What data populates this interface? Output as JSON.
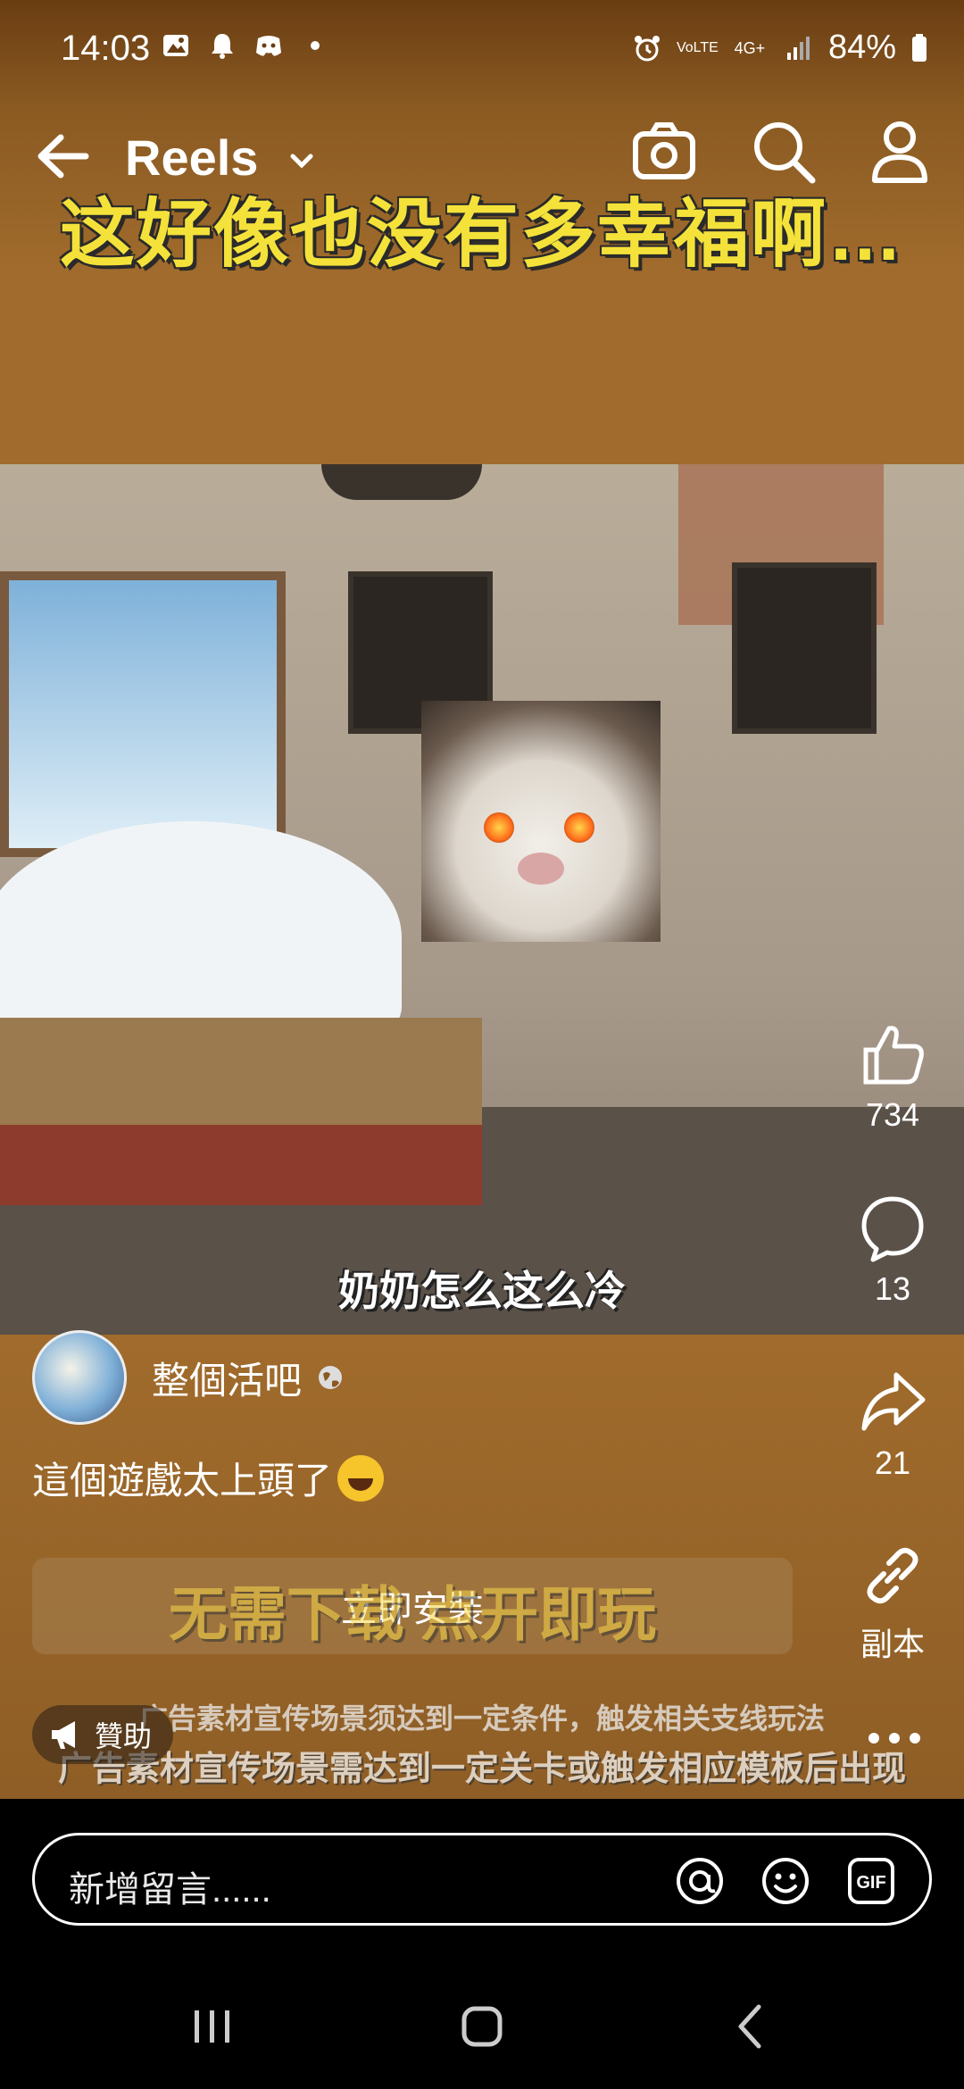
{
  "status_bar": {
    "time": "14:03",
    "network": "4G+",
    "volte": "VoLTE",
    "battery": "84%"
  },
  "app_bar": {
    "title": "Reels",
    "icons": [
      "back-arrow-icon",
      "chevron-down-icon",
      "camera-icon",
      "search-icon",
      "profile-icon"
    ]
  },
  "video": {
    "banner_text": "这好像也没有多幸福啊…",
    "subtitle_text": "奶奶怎么这么冷",
    "install_overlay_text": "无需下载 点开即玩",
    "ad_note_1": "广告素材宣传场景须达到一定条件，触发相关支线玩法",
    "ad_note_2": "广告素材宣传场景需达到一定关卡或触发相应模板后出现"
  },
  "actions": {
    "likes": "734",
    "comments": "13",
    "shares": "21",
    "copy_link_label": "副本"
  },
  "post": {
    "author": "整個活吧",
    "caption": "這個遊戲太上頭了",
    "install_button": "立即安裝",
    "sponsored_label": "贊助"
  },
  "comment_bar": {
    "placeholder": "新增留言......",
    "icons": [
      "mention-icon",
      "emoji-icon",
      "gif-icon"
    ]
  },
  "colors": {
    "banner_yellow": "#f4e23a",
    "background_brown": "#a06b2c"
  }
}
